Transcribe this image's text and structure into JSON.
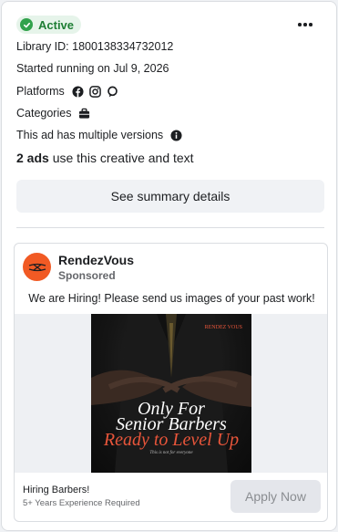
{
  "status": {
    "label": "Active",
    "color": "#31a24c"
  },
  "library_id": "Library ID: 1800138334732012",
  "started": "Started running on Jul 9, 2026",
  "platforms": {
    "label": "Platforms",
    "icons": [
      "facebook-icon",
      "instagram-icon",
      "messenger-icon"
    ]
  },
  "categories": {
    "label": "Categories",
    "icons": [
      "briefcase-icon"
    ]
  },
  "versions": "This ad has multiple versions",
  "ads_count": {
    "number": "2 ads",
    "text": " use this creative and text"
  },
  "summary_button": "See summary details",
  "ad": {
    "advertiser": "RendezVous",
    "sponsored": "Sponsored",
    "body": "We are Hiring! Please send us images of your past work!",
    "creative": {
      "line1": "Only For",
      "line2": "Senior Barbers",
      "line3": "Ready to Level Up",
      "tiny": "This is not for everyone",
      "brand": "RENDEZ VOUS"
    },
    "footer_title": "Hiring Barbers!",
    "footer_subtitle": "5+ Years Experience Required",
    "cta": "Apply Now"
  }
}
